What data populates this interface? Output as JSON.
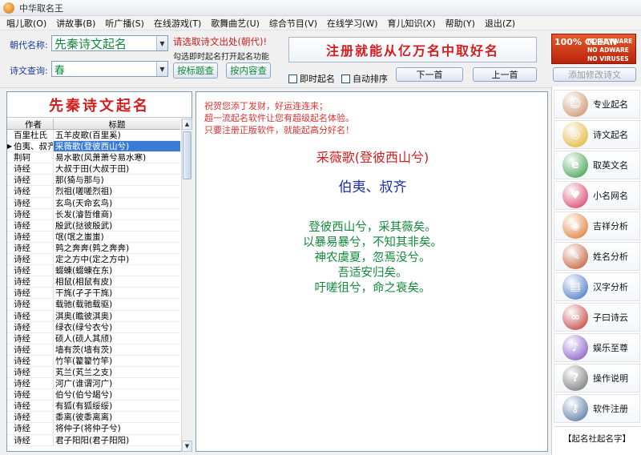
{
  "window": {
    "title": "中华取名王"
  },
  "menu": [
    "唱儿歌(O)",
    "讲故事(B)",
    "听广播(S)",
    "在线游戏(T)",
    "歌舞曲艺(U)",
    "综合节目(V)",
    "在线学习(W)",
    "育儿知识(X)",
    "帮助(Y)",
    "退出(Z)"
  ],
  "toolbar": {
    "dynasty_label": "朝代名称:",
    "dynasty_value": "先秦诗文起名",
    "query_label": "诗文查询:",
    "query_value": "春",
    "hint_red": "请选取诗文出处(朝代)!",
    "hint_black": "勾选即时起名打开起名功能",
    "btn_title_search": "按标题查",
    "btn_content_search": "按内容查",
    "banner": "注册就能从亿万名中取好名",
    "chk_instant": "即时起名",
    "chk_autosort": "自动排序",
    "btn_next": "下一首",
    "btn_prev": "上一首",
    "btn_add_edit": "添加修改诗文",
    "badge_big": "100% CLEAN",
    "badge_lines": [
      "NO SPYWARE",
      "NO ADWARE",
      "NO VIRUSES"
    ]
  },
  "left": {
    "header": "先秦诗文起名",
    "col_author": "作者",
    "col_title": "标题",
    "rows": [
      {
        "author": "百里杜氏",
        "title": "五羊皮歌(百里奚)"
      },
      {
        "author": "伯夷、叔齐",
        "title": "采薇歌(登彼西山兮)",
        "selected": true
      },
      {
        "author": "荆轲",
        "title": "易水歌(风萧萧兮易水寒)"
      },
      {
        "author": "诗经",
        "title": "大叔于田(大叔于田)"
      },
      {
        "author": "诗经",
        "title": "那(猗与那与)"
      },
      {
        "author": "诗经",
        "title": "烈祖(嗟嗟烈祖)"
      },
      {
        "author": "诗经",
        "title": "玄鸟(天命玄鸟)"
      },
      {
        "author": "诗经",
        "title": "长发(濬哲维商)"
      },
      {
        "author": "诗经",
        "title": "殷武(挞彼殷武)"
      },
      {
        "author": "诗经",
        "title": "氓(氓之蚩蚩)"
      },
      {
        "author": "诗经",
        "title": "鹑之奔奔(鹑之奔奔)"
      },
      {
        "author": "诗经",
        "title": "定之方中(定之方中)"
      },
      {
        "author": "诗经",
        "title": "蝃蝀(蝃蝀在东)"
      },
      {
        "author": "诗经",
        "title": "相鼠(相鼠有皮)"
      },
      {
        "author": "诗经",
        "title": "干旄(孑孑干旄)"
      },
      {
        "author": "诗经",
        "title": "载驰(载驰载驱)"
      },
      {
        "author": "诗经",
        "title": "淇奥(瞻彼淇奥)"
      },
      {
        "author": "诗经",
        "title": "绿衣(绿兮衣兮)"
      },
      {
        "author": "诗经",
        "title": "硕人(硕人其颀)"
      },
      {
        "author": "诗经",
        "title": "墙有茨(墙有茨)"
      },
      {
        "author": "诗经",
        "title": "竹竿(籊籊竹竿)"
      },
      {
        "author": "诗经",
        "title": "芄兰(芄兰之支)"
      },
      {
        "author": "诗经",
        "title": "河广(谁谓河广)"
      },
      {
        "author": "诗经",
        "title": "伯兮(伯兮朅兮)"
      },
      {
        "author": "诗经",
        "title": "有狐(有狐绥绥)"
      },
      {
        "author": "诗经",
        "title": "黍离(彼黍离离)"
      },
      {
        "author": "诗经",
        "title": "将仲子(将仲子兮)"
      },
      {
        "author": "诗经",
        "title": "君子阳阳(君子阳阳)"
      }
    ]
  },
  "main": {
    "promo": [
      "祝贺您添丁发财，好运连连来；",
      "超一流起名软件让您有超级起名体验。",
      "只要注册正版软件，就能起高分好名！"
    ],
    "poem_title": "采薇歌(登彼西山兮)",
    "poem_author": "伯夷、叔齐",
    "poem_lines": [
      "登彼西山兮，采其薇矣。",
      "以暴易暴兮，不知其非矣。",
      "神农虞夏，忽焉没兮。",
      "吾适安归矣。",
      "吁嗟徂兮，命之衰矣。"
    ]
  },
  "sidebar": {
    "items": [
      {
        "label": "专业起名",
        "icon": "person-icon",
        "color": "#c98a5a"
      },
      {
        "label": "诗文起名",
        "icon": "disc-icon",
        "color": "#e0b020"
      },
      {
        "label": "取英文名",
        "icon": "book-icon",
        "color": "#2a9a3a"
      },
      {
        "label": "小名网名",
        "icon": "heart-icon",
        "color": "#d8305a"
      },
      {
        "label": "吉祥分析",
        "icon": "orb-icon",
        "color": "#e07020"
      },
      {
        "label": "姓名分析",
        "icon": "pencil-icon",
        "color": "#c05020"
      },
      {
        "label": "汉字分析",
        "icon": "books-icon",
        "color": "#3a6ac0"
      },
      {
        "label": "子曰诗云",
        "icon": "knot-icon",
        "color": "#c0302a"
      },
      {
        "label": "娱乐至尊",
        "icon": "music-icon",
        "color": "#7a4ac0"
      },
      {
        "label": "操作说明",
        "icon": "help-icon",
        "color": "#6a6a6a"
      },
      {
        "label": "软件注册",
        "icon": "key-icon",
        "color": "#4a6a9a"
      }
    ],
    "footer": "【起名社起名字】"
  }
}
